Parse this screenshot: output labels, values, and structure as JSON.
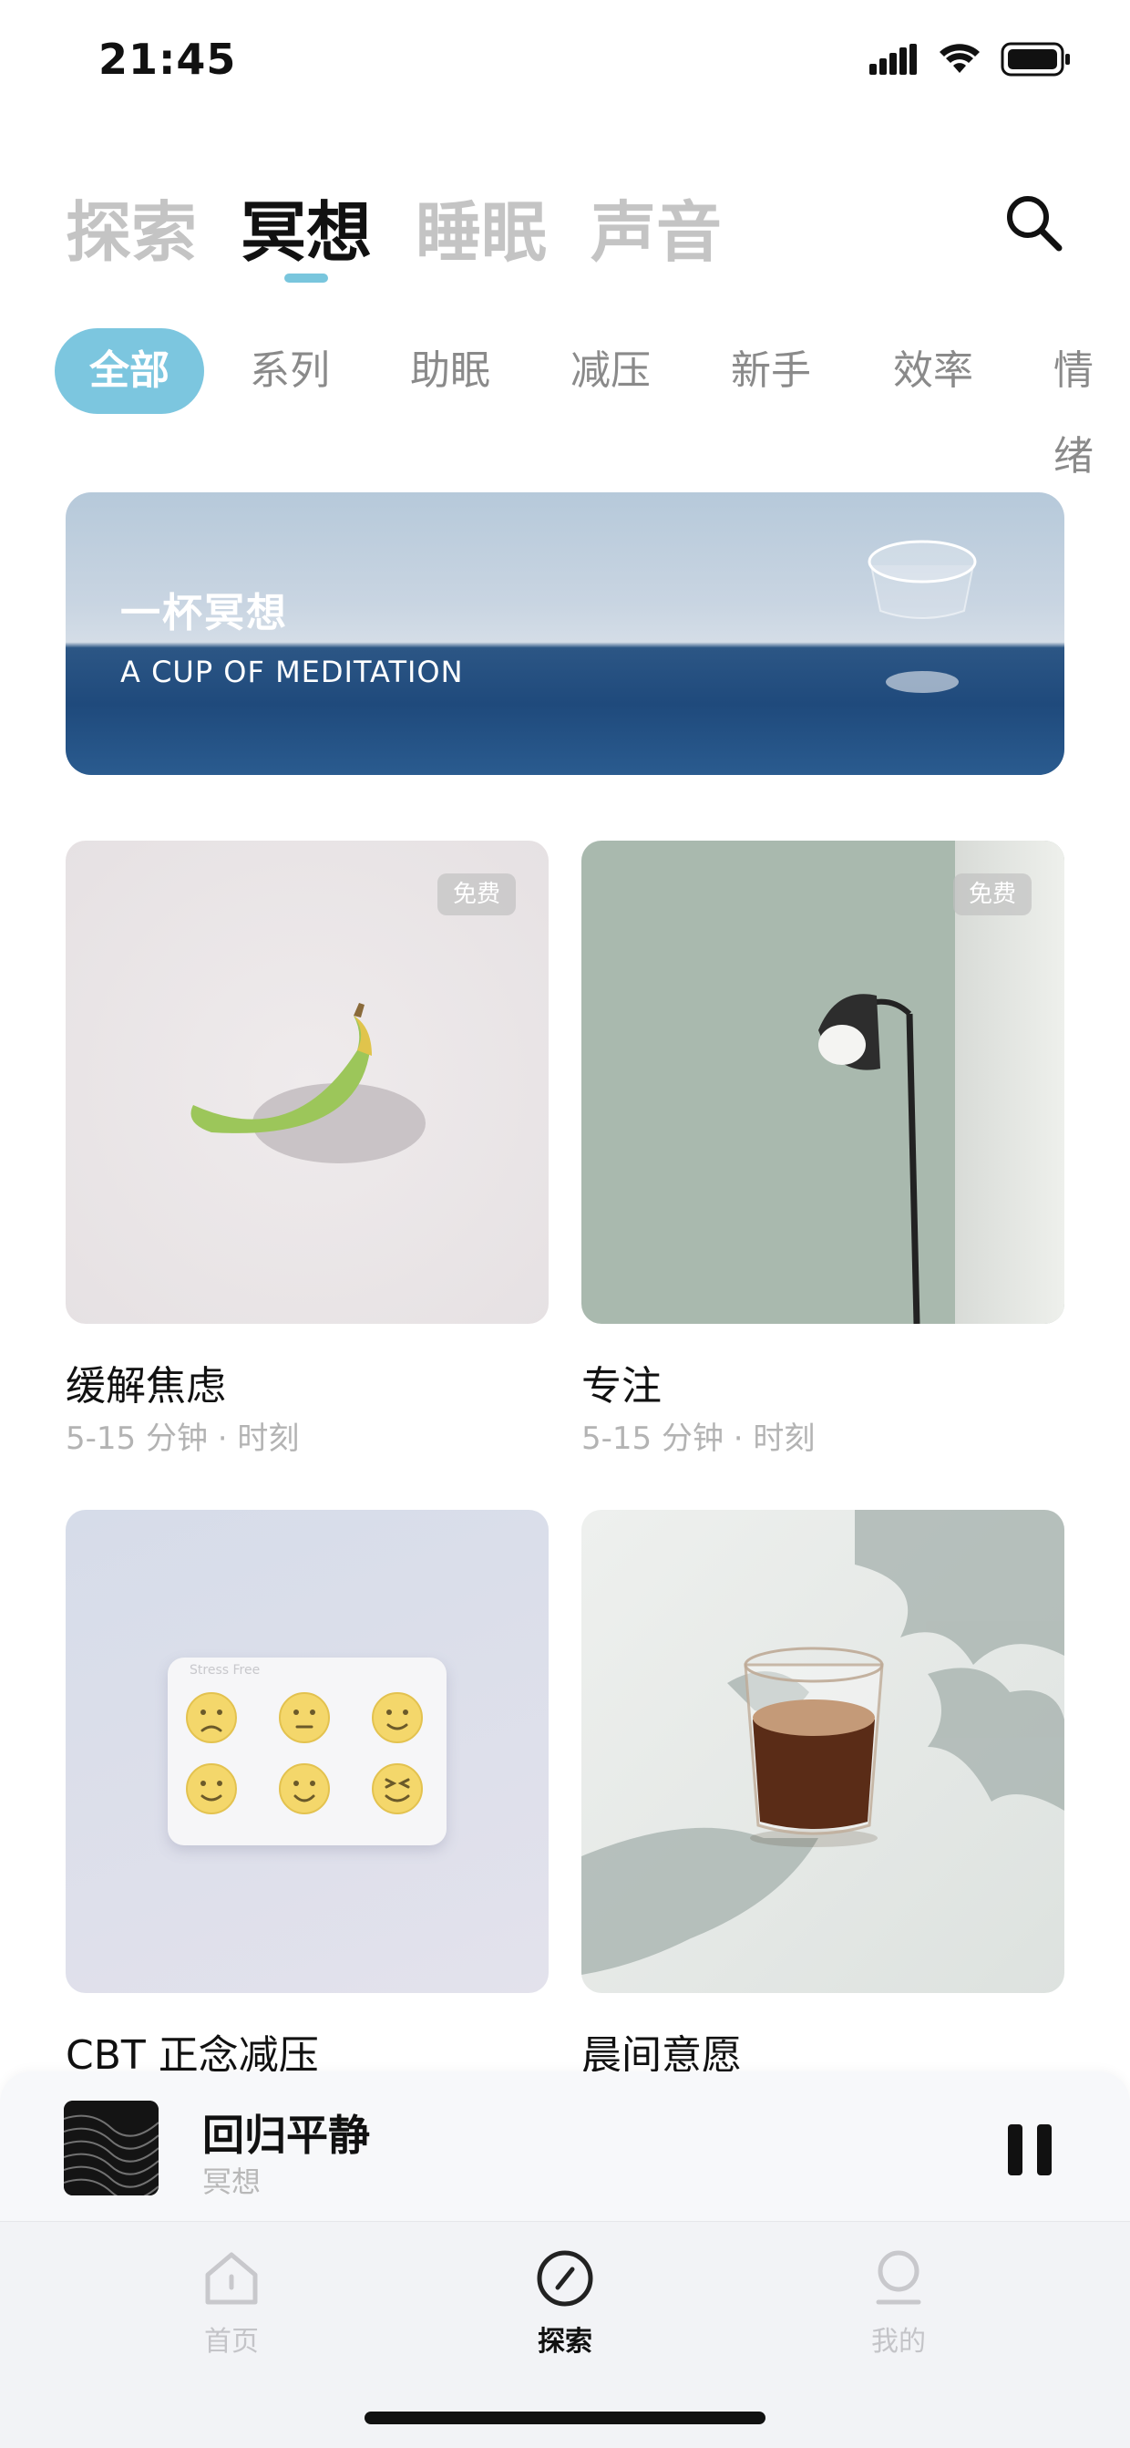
{
  "status": {
    "time": "21:45"
  },
  "top_tabs": [
    "探索",
    "冥想",
    "睡眠",
    "声音"
  ],
  "active_top_tab": "冥想",
  "categories": [
    "全部",
    "系列",
    "助眠",
    "减压",
    "新手",
    "效率",
    "情绪"
  ],
  "active_category": "全部",
  "banner": {
    "title": "一杯冥想",
    "subtitle": "A CUP OF MEDITATION"
  },
  "cards": [
    {
      "title": "缓解焦虑",
      "subtitle": "5-15 分钟 · 时刻",
      "badge": "免费"
    },
    {
      "title": "专注",
      "subtitle": "5-15 分钟 · 时刻",
      "badge": "免费"
    },
    {
      "title": "CBT 正念减压",
      "subtitle": ""
    },
    {
      "title": "晨间意愿",
      "subtitle": ""
    }
  ],
  "pill_box_label": "Stress Free",
  "player": {
    "title": "回归平静",
    "subtitle": "冥想",
    "state": "playing"
  },
  "tabbar": [
    {
      "label": "首页",
      "icon": "home-icon"
    },
    {
      "label": "探索",
      "icon": "compass-icon"
    },
    {
      "label": "我的",
      "icon": "profile-icon"
    }
  ],
  "colors": {
    "accent": "#7cc6df",
    "inactive": "#c4c4c4"
  }
}
